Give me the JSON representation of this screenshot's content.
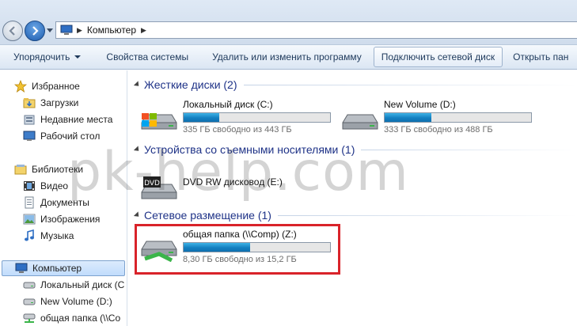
{
  "address": {
    "path": "Компьютер"
  },
  "toolbar": {
    "organize": "Упорядочить",
    "system_properties": "Свойства системы",
    "uninstall": "Удалить или изменить программу",
    "map_drive": "Подключить сетевой диск",
    "open_panel": "Открыть пан"
  },
  "sidebar": {
    "favorites": "Избранное",
    "downloads": "Загрузки",
    "recent": "Недавние места",
    "desktop": "Рабочий стол",
    "libraries": "Библиотеки",
    "video": "Видео",
    "documents": "Документы",
    "images": "Изображения",
    "music": "Музыка",
    "computer": "Компьютер",
    "local_disk": "Локальный диск (С",
    "new_volume": "New Volume (D:)",
    "shared": "общая папка (\\\\Co"
  },
  "groups": {
    "hdd": "Жесткие диски (2)",
    "removable": "Устройства со съемными носителями (1)",
    "network": "Сетевое размещение (1)"
  },
  "drives": {
    "c": {
      "name": "Локальный диск (C:)",
      "info": "335 ГБ свободно из 443 ГБ",
      "used_fraction": 0.244
    },
    "d": {
      "name": "New Volume (D:)",
      "info": "333 ГБ свободно из 488 ГБ",
      "used_fraction": 0.318
    },
    "e": {
      "name": "DVD RW дисковод (E:)",
      "dvd_label": "DVD"
    },
    "z": {
      "name": "общая папка (\\\\Comp) (Z:)",
      "info": "8,30 ГБ свободно из 15,2 ГБ",
      "used_fraction": 0.454
    }
  },
  "watermark": "pk-help.com",
  "colors": {
    "accent": "#1e3287",
    "highlight": "#d9232a",
    "bar_fill": "#1380c1"
  }
}
